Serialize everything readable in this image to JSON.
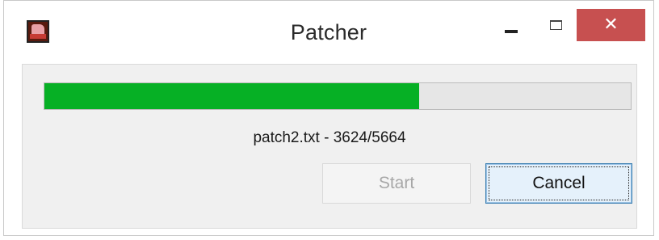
{
  "window": {
    "title": "Patcher",
    "controls": {
      "minimize": "minimize-icon",
      "maximize": "maximize-icon",
      "close_label": "✕"
    }
  },
  "progress": {
    "fraction": 0.6398,
    "fill_color": "#06b025"
  },
  "status": {
    "text": "patch2.txt - 3624/5664"
  },
  "buttons": {
    "start_label": "Start",
    "cancel_label": "Cancel"
  },
  "colors": {
    "close_button": "#c75050",
    "disabled_text": "#a7a7a7"
  }
}
